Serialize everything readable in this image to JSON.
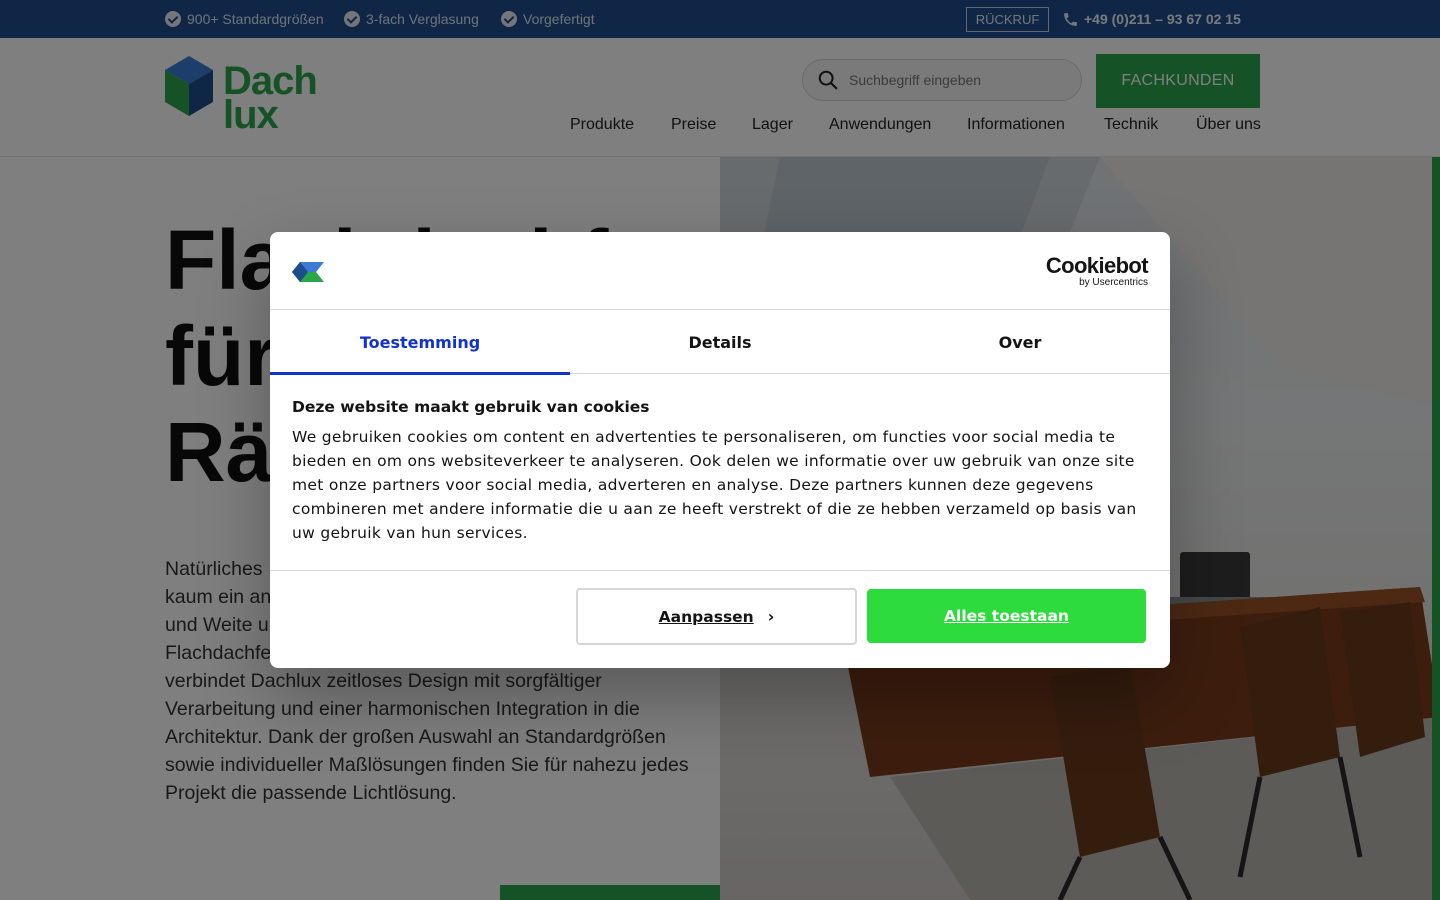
{
  "topbar": {
    "usps": [
      "900+ Standardgrößen",
      "3-fach Verglasung",
      "Vorgefertigt"
    ],
    "callback_label": "RÜCKRUF",
    "phone": "+49 (0)211 – 93 67 02 15"
  },
  "header": {
    "logo_line1": "Dach",
    "logo_line2": "lux",
    "search_placeholder": "Suchbegriff eingeben",
    "fachkunden_label": "FACHKUNDEN",
    "nav": [
      "Produkte",
      "Preise",
      "Lager",
      "Anwendungen",
      "Informationen",
      "Technik",
      "Über uns"
    ]
  },
  "hero": {
    "title_lines": [
      "Flachdachf",
      "für",
      "Räu"
    ],
    "text_lines": [
      "Natürliches",
      "kaum ein an",
      "und Weite u",
      "Flachdachfe",
      "verbindet Dachlux zeitloses Design mit sorgfältiger",
      "Verarbeitung und einer harmonischen Integration in die",
      "Architektur. Dank der großen Auswahl an Standardgrößen",
      "sowie individueller Maßlösungen finden Sie für nahezu jedes",
      "Projekt die passende Lichtlösung."
    ]
  },
  "cookie": {
    "brand": "Cookiebot",
    "brand_sub": "by Usercentrics",
    "tabs": [
      "Toestemming",
      "Details",
      "Over"
    ],
    "active_tab": "Toestemming",
    "heading": "Deze website maakt gebruik van cookies",
    "body": "We gebruiken cookies om content en advertenties te personaliseren, om functies voor social media te bieden en om ons websiteverkeer te analyseren. Ook delen we informatie over uw gebruik van onze site met onze partners voor social media, adverteren en analyse. Deze partners kunnen deze gegevens combineren met andere informatie die u aan ze heeft verstrekt of die ze hebben verzameld op basis van uw gebruik van hun services.",
    "customize_label": "Aanpassen",
    "allow_all_label": "Alles toestaan"
  },
  "colors": {
    "topbar": "#1f4d8c",
    "brand_green": "#2aa54a",
    "cookie_accent": "#1032cf",
    "allow_button": "#2edb3c"
  }
}
